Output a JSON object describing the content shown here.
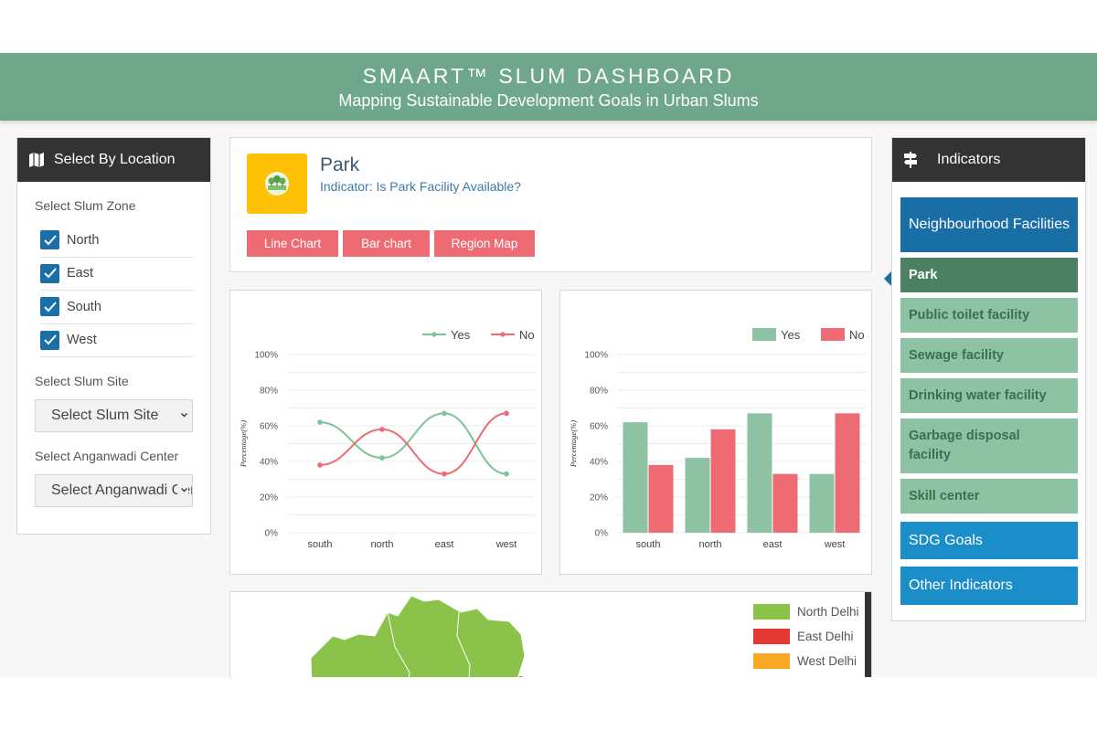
{
  "header": {
    "title": "SMAART™ SLUM DASHBOARD",
    "subtitle": "Mapping Sustainable Development Goals in Urban Slums"
  },
  "location_panel": {
    "title": "Select By Location",
    "icon": "map-icon",
    "zone_label": "Select Slum Zone",
    "zones": [
      {
        "label": "North",
        "checked": true
      },
      {
        "label": "East",
        "checked": true
      },
      {
        "label": "South",
        "checked": true
      },
      {
        "label": "West",
        "checked": true
      }
    ],
    "site_label": "Select Slum Site",
    "site_select": "Select Slum Site",
    "anganwadi_label": "Select Anganwadi Center",
    "anganwadi_select": "Select Anganwadi Center"
  },
  "indicator": {
    "icon": "park-icon",
    "title": "Park",
    "subtitle": "Indicator: Is Park Facility Available?",
    "buttons": [
      "Line Chart",
      "Bar chart",
      "Region Map"
    ]
  },
  "colors": {
    "header": "#6fa78a",
    "yes": "#8dc3a2",
    "no": "#ee6b73",
    "button": "#ee6b73",
    "tab_blue": "#1a6ea6",
    "tab_light_blue": "#1b8dc8",
    "item_green": "#8dc3a2",
    "item_active": "#4b8062"
  },
  "chart_data": [
    {
      "type": "line",
      "categories": [
        "south",
        "north",
        "east",
        "west"
      ],
      "series": [
        {
          "name": "Yes",
          "values": [
            62,
            42,
            67,
            33
          ]
        },
        {
          "name": "No",
          "values": [
            38,
            58,
            33,
            67
          ]
        }
      ],
      "ylabel": "Percentage(%)",
      "yticks": [
        "0%",
        "20%",
        "40%",
        "60%",
        "80%",
        "100%"
      ],
      "ylim": [
        0,
        100
      ],
      "legend": "top-right",
      "grid": true
    },
    {
      "type": "bar",
      "categories": [
        "south",
        "north",
        "east",
        "west"
      ],
      "series": [
        {
          "name": "Yes",
          "values": [
            62,
            42,
            67,
            33
          ]
        },
        {
          "name": "No",
          "values": [
            38,
            58,
            33,
            67
          ]
        }
      ],
      "ylabel": "Percentage(%)",
      "yticks": [
        "0%",
        "20%",
        "40%",
        "60%",
        "80%",
        "100%"
      ],
      "ylim": [
        0,
        100
      ],
      "legend": "top-right",
      "grid": true
    }
  ],
  "map": {
    "legend": [
      {
        "label": "North Delhi",
        "color": "#8bc34a"
      },
      {
        "label": "East Delhi",
        "color": "#e53935"
      },
      {
        "label": "West Delhi",
        "color": "#f9a825"
      }
    ]
  },
  "indicators_panel": {
    "title": "Indicators",
    "icon": "signpost-icon",
    "category": "Neighbourhood Facilities",
    "items": [
      {
        "label": "Park",
        "active": true
      },
      {
        "label": "Public toilet facility",
        "active": false
      },
      {
        "label": "Sewage facility",
        "active": false
      },
      {
        "label": "Drinking water facility",
        "active": false
      },
      {
        "label": "Garbage disposal facility",
        "active": false
      },
      {
        "label": "Skill center",
        "active": false
      }
    ],
    "tabs": [
      "SDG Goals",
      "Other Indicators"
    ]
  }
}
